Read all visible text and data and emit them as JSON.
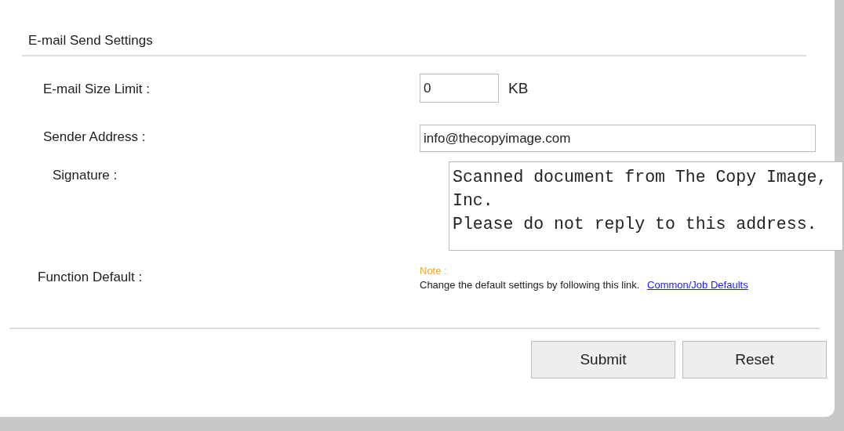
{
  "section": {
    "title": "E-mail Send Settings"
  },
  "fields": [
    {
      "kind": "short",
      "label": "E-mail Size Limit :",
      "value": "0",
      "unit": "KB"
    },
    {
      "kind": "text",
      "label": "Sender Address :",
      "value": "info@thecopyimage.com"
    },
    {
      "kind": "multiline",
      "label": "Signature :",
      "value": "Scanned document from The Copy Image, Inc.\nPlease do not reply to this address."
    },
    {
      "kind": "note",
      "label": "Function Default :",
      "note_title": "Note :",
      "text": "Change the default settings by following this link.",
      "link": "Common/Job Defaults"
    }
  ],
  "buttons": [
    "Submit",
    "Reset"
  ]
}
